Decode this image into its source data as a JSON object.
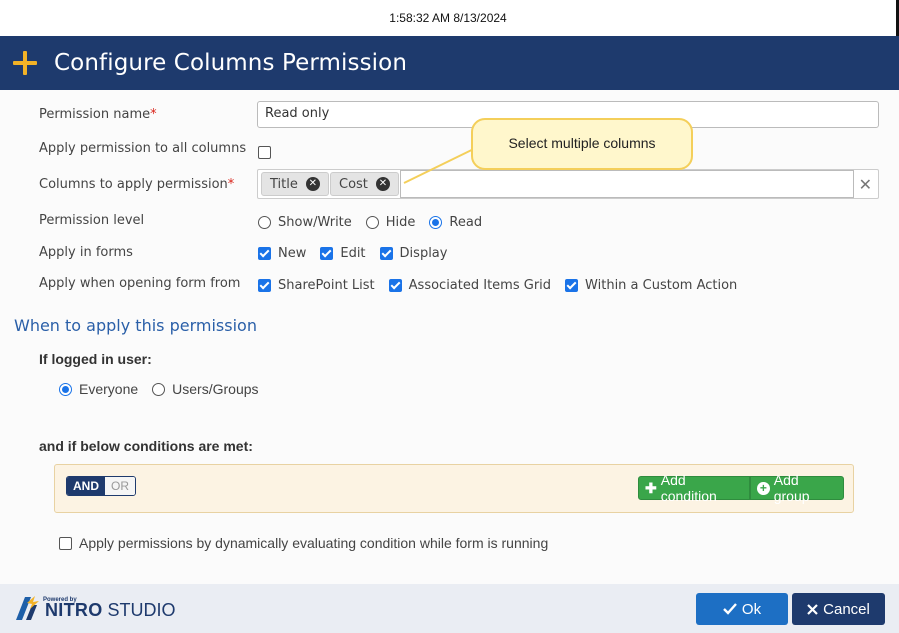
{
  "timestamp": "1:58:32 AM 8/13/2024",
  "header": {
    "title": "Configure Columns Permission",
    "icon": "plus-icon"
  },
  "form": {
    "permission_name": {
      "label": "Permission name",
      "required_mark": "*",
      "value": "Read only"
    },
    "apply_all": {
      "label": "Apply permission to all columns",
      "checked": false
    },
    "columns": {
      "label": "Columns to apply permission",
      "required_mark": "*",
      "tags": [
        "Title",
        "Cost"
      ],
      "remove_glyph": "✕",
      "clear_glyph": "✕"
    },
    "callout": "Select multiple columns",
    "permission_level": {
      "label": "Permission level",
      "options": [
        "Show/Write",
        "Hide",
        "Read"
      ],
      "selected": "Read"
    },
    "apply_in_forms": {
      "label": "Apply in forms",
      "options": [
        "New",
        "Edit",
        "Display"
      ]
    },
    "apply_when_opening": {
      "label": "Apply when opening form from",
      "options": [
        "SharePoint List",
        "Associated Items Grid",
        "Within a Custom Action"
      ]
    }
  },
  "when": {
    "title": "When to apply this permission",
    "logged_in_label": "If logged in user:",
    "user_options": [
      "Everyone",
      "Users/Groups"
    ],
    "selected_user": "Everyone",
    "conditions_label": "and if below conditions are met:",
    "and_label": "AND",
    "or_label": "OR",
    "add_condition": "Add condition",
    "add_group": "Add group",
    "dynamic_label": "Apply permissions by dynamically evaluating condition while form is running"
  },
  "footer": {
    "logo_powered": "Powered by",
    "logo_nitro": "NITRO",
    "logo_studio": "STUDIO",
    "ok": "Ok",
    "cancel": "Cancel"
  },
  "colors": {
    "header_bg": "#1e3a6d",
    "accent_yellow": "#f2b227",
    "ok_bg": "#1d6fc4",
    "cancel_bg": "#1e3a6d",
    "green": "#3aa64a"
  }
}
